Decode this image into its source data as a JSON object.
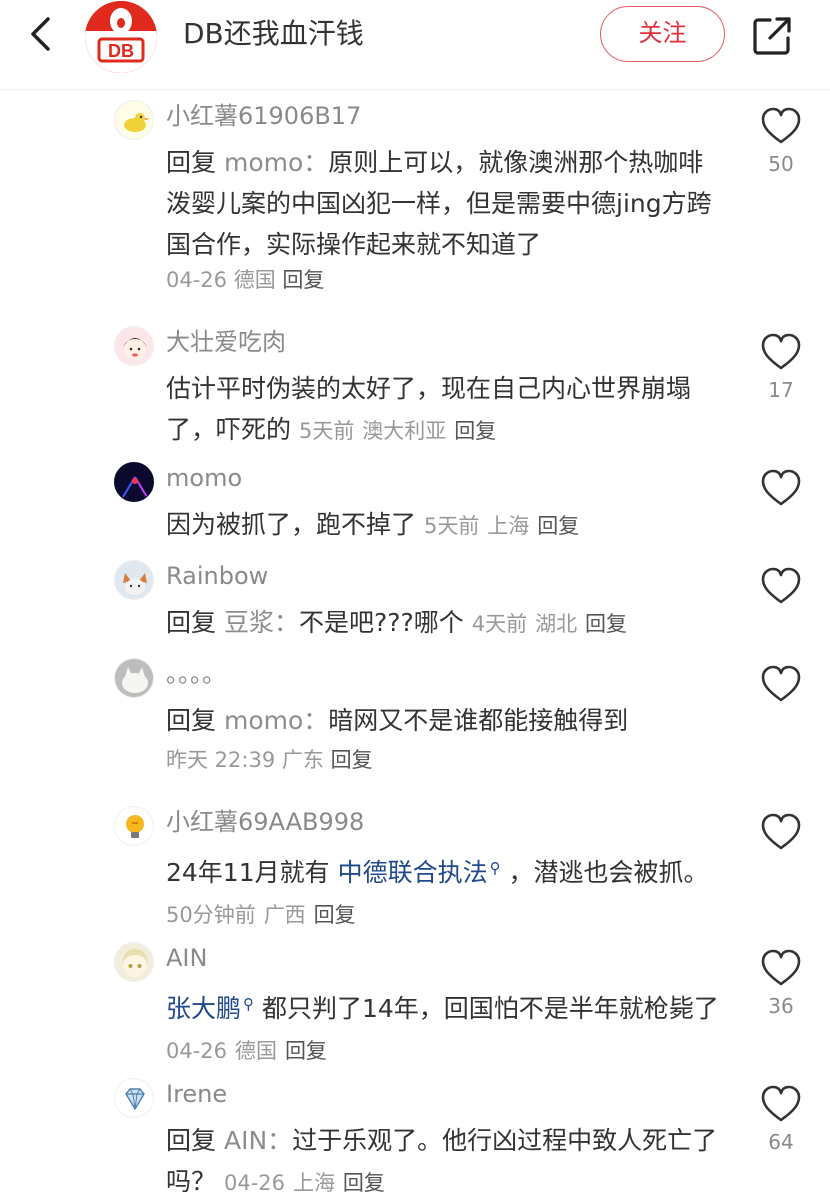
{
  "header": {
    "title": "DB还我血汗钱",
    "avatar_text": "DB",
    "follow_label": "关注"
  },
  "colors": {
    "accent": "#e0303b",
    "link": "#1f4a8c",
    "muted": "#999999"
  },
  "comments": [
    {
      "name": "小红薯61906B17",
      "reply_prefix": "回复",
      "reply_to": "momo",
      "sep": "：",
      "text": "原则上可以，就像澳洲那个热咖啡泼婴儿案的中国凶犯一样，但是需要中德jing方跨国合作，实际操作起来就不知道了",
      "date": "04-26",
      "location": "德国",
      "reply_label": "回复",
      "likes": "50"
    },
    {
      "name": "大壮爱吃肉",
      "text": "估计平时伪装的太好了，现在自己内心世界崩塌了，吓死的",
      "date": "5天前",
      "location": "澳大利亚",
      "reply_label": "回复",
      "likes": "17"
    },
    {
      "name": "momo",
      "text": "因为被抓了，跑不掉了",
      "date": "5天前",
      "location": "上海",
      "reply_label": "回复"
    },
    {
      "name": "Rainbow",
      "reply_prefix": "回复",
      "reply_to": "豆浆",
      "sep": "：",
      "text": "不是吧???哪个",
      "date": "4天前",
      "location": "湖北",
      "reply_label": "回复"
    },
    {
      "name": "。。。。",
      "reply_prefix": "回复",
      "reply_to": "momo",
      "sep": "：",
      "text": "暗网又不是谁都能接触得到",
      "date": "昨天 22:39",
      "location": "广东",
      "reply_label": "回复"
    },
    {
      "name": "小红薯69AAB998",
      "text_before": "24年11月就有 ",
      "link": "中德联合执法",
      "text_after": " ，潜逃也会被抓。",
      "date": "50分钟前",
      "location": "广西",
      "reply_label": "回复"
    },
    {
      "name": "AIN",
      "link": "张大鹏",
      "text_after": " 都只判了14年，回国怕不是半年就枪毙了",
      "date": "04-26",
      "location": "德国",
      "reply_label": "回复",
      "likes": "36"
    },
    {
      "name": "Irene",
      "reply_prefix": "回复",
      "reply_to": "AIN",
      "sep": "：",
      "text": "过于乐观了。他行凶过程中致人死亡了吗？",
      "date": "04-26",
      "location": "上海",
      "reply_label": "回复",
      "likes": "64"
    }
  ]
}
